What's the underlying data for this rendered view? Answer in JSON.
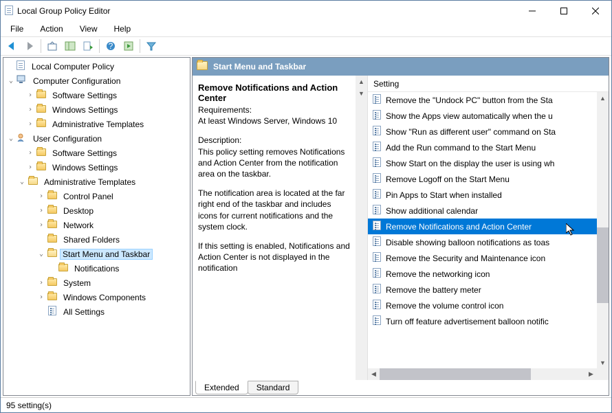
{
  "window": {
    "title": "Local Group Policy Editor"
  },
  "menu": {
    "file": "File",
    "action": "Action",
    "view": "View",
    "help": "Help"
  },
  "tree": {
    "root": "Local Computer Policy",
    "cc": "Computer Configuration",
    "cc_sw": "Software Settings",
    "cc_ws": "Windows Settings",
    "cc_at": "Administrative Templates",
    "uc": "User Configuration",
    "uc_sw": "Software Settings",
    "uc_ws": "Windows Settings",
    "uc_at": "Administrative Templates",
    "cp": "Control Panel",
    "dk": "Desktop",
    "nw": "Network",
    "sf": "Shared Folders",
    "smt": "Start Menu and Taskbar",
    "no": "Notifications",
    "sy": "System",
    "wc": "Windows Components",
    "as": "All Settings"
  },
  "header": {
    "title": "Start Menu and Taskbar"
  },
  "desc": {
    "title": "Remove Notifications and Action Center",
    "req_label": "Requirements:",
    "req": "At least Windows Server, Windows 10",
    "d_label": "Description:",
    "d1": "This policy setting removes Notifications and Action Center from the notification area on the taskbar.",
    "d2": "The notification area is located at the far right end of the taskbar and includes icons for current notifications and the system clock.",
    "d3": "If this setting is enabled, Notifications and Action Center is not displayed in the notification"
  },
  "list": {
    "col": "Setting",
    "items": [
      "Remove the \"Undock PC\" button from the Sta",
      "Show the Apps view automatically when the u",
      "Show \"Run as different user\" command on Sta",
      "Add the Run command to the Start Menu",
      "Show Start on the display the user is using wh",
      "Remove Logoff on the Start Menu",
      "Pin Apps to Start when installed",
      "Show additional calendar",
      "Remove Notifications and Action Center",
      "Disable showing balloon notifications as toas",
      "Remove the Security and Maintenance icon",
      "Remove the networking icon",
      "Remove the battery meter",
      "Remove the volume control icon",
      "Turn off feature advertisement balloon notific"
    ]
  },
  "tabs": {
    "extended": "Extended",
    "standard": "Standard"
  },
  "status": {
    "text": "95 setting(s)"
  }
}
